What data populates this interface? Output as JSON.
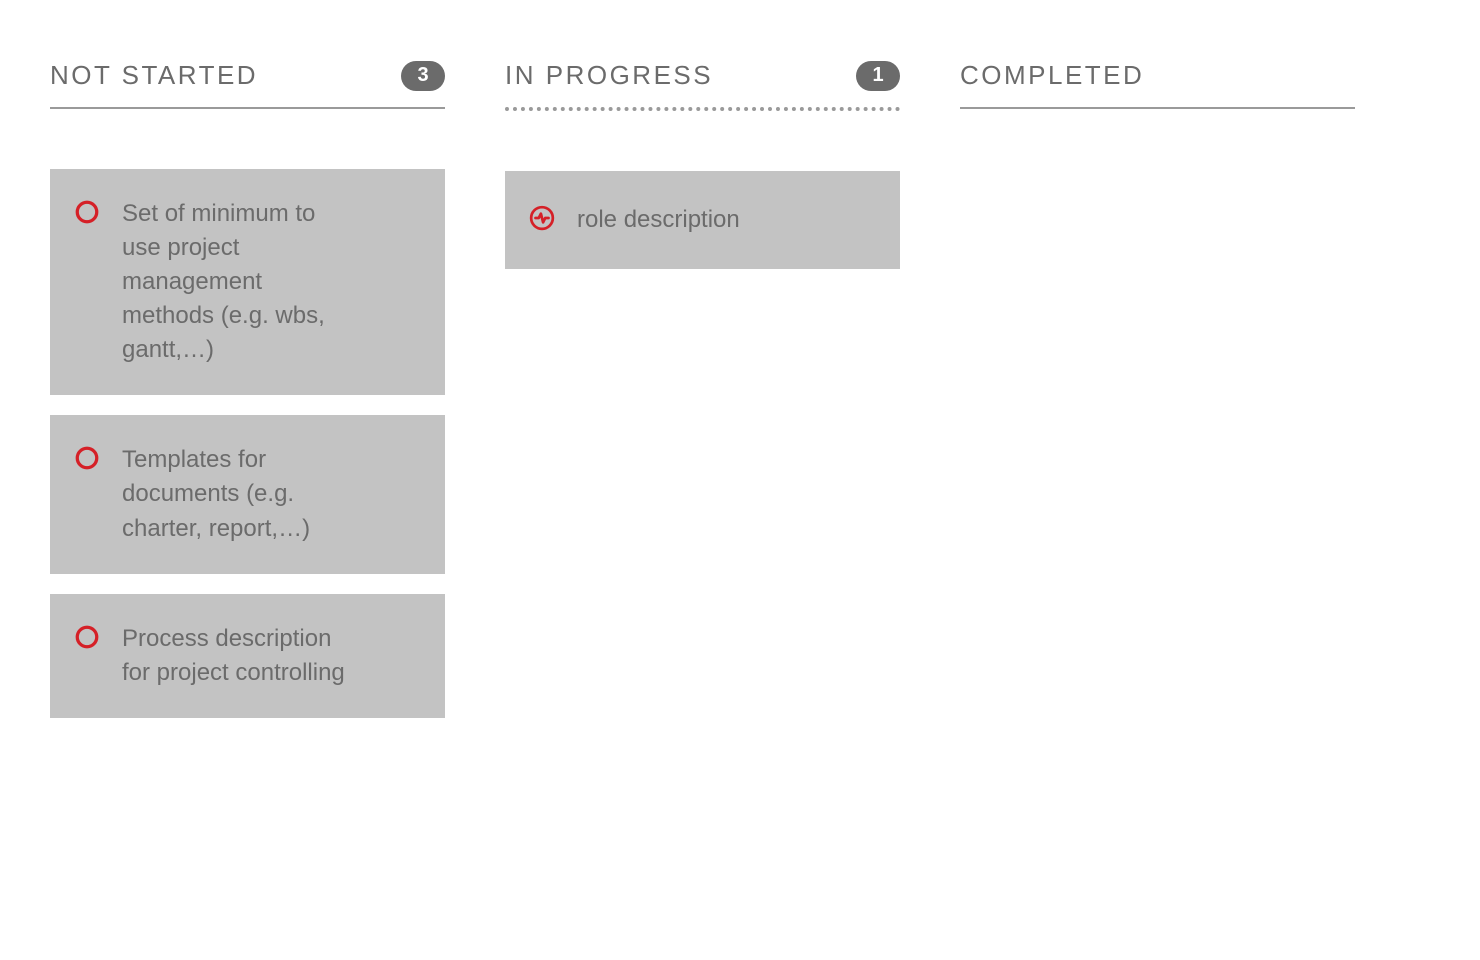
{
  "columns": [
    {
      "id": "not_started",
      "title": "NOT STARTED",
      "count": "3",
      "border": "solid",
      "cards": [
        {
          "icon": "circle",
          "title": "Set of minimum to use project management methods (e.g. wbs, gantt,…)"
        },
        {
          "icon": "circle",
          "title": "Templates for documents (e.g. charter, report,…)"
        },
        {
          "icon": "circle",
          "title": "Process description for project controlling"
        }
      ]
    },
    {
      "id": "in_progress",
      "title": "IN PROGRESS",
      "count": "1",
      "border": "dotted",
      "cards": [
        {
          "icon": "activity-circle",
          "title": "role description"
        }
      ]
    },
    {
      "id": "completed",
      "title": "COMPLETED",
      "count": null,
      "border": "solid",
      "cards": []
    }
  ],
  "colors": {
    "accent": "#D52027",
    "muted": "#6b6b6b",
    "card_bg": "#c3c3c3"
  }
}
